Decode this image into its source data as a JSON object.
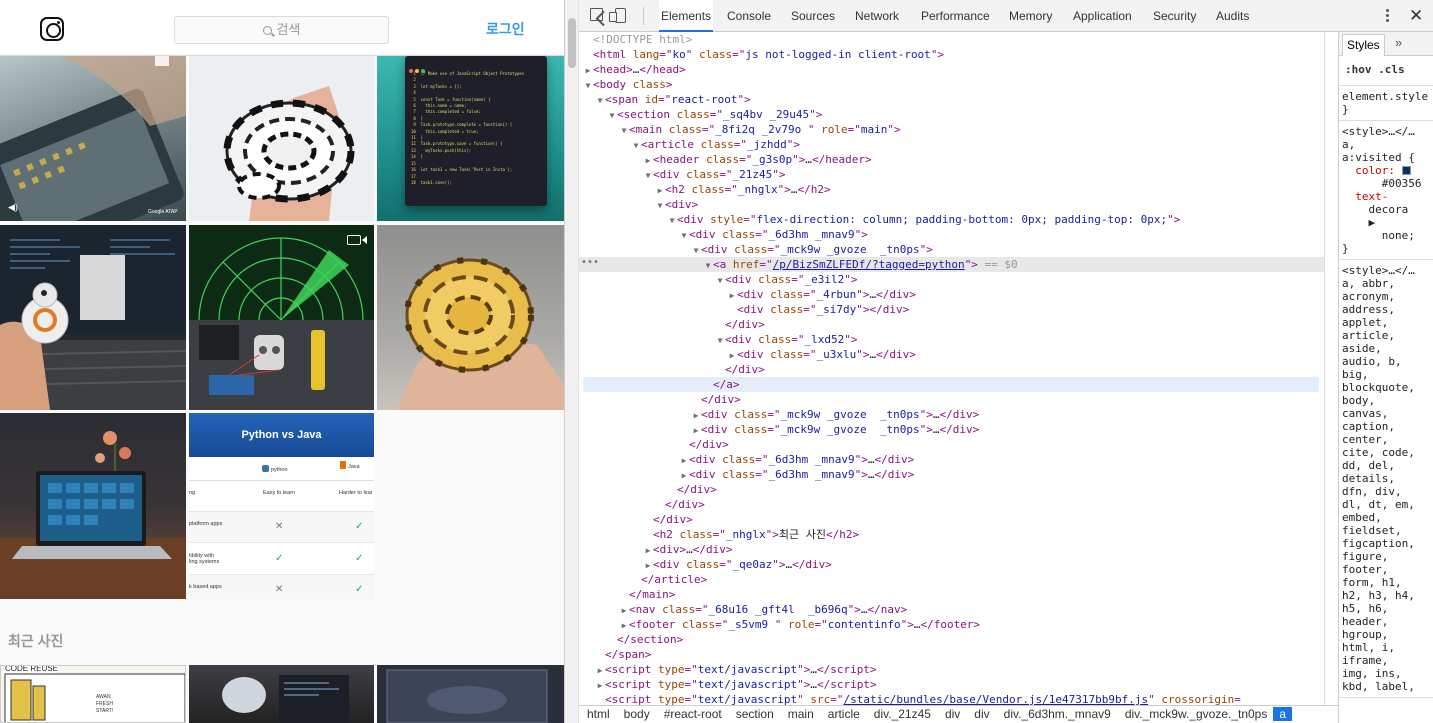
{
  "instagram": {
    "search_placeholder": "검색",
    "login_label": "로그인",
    "recent_photos_title": "최근 사진",
    "python_vs_java": {
      "title": "Python vs Java",
      "col1": "python",
      "col2": "Java",
      "rows": [
        {
          "label": "ng",
          "py": "Easy to learn",
          "java": "Harder to lear"
        },
        {
          "label": "platform apps",
          "py": "✕",
          "java": "✓"
        },
        {
          "label": "tibility with\nling systems",
          "py": "✓",
          "java": "✓"
        },
        {
          "label": "k based apps",
          "py": "✕",
          "java": "✓"
        }
      ]
    },
    "code_tile_lines": [
      "// Make use of JavaScript Object Prototypes",
      "",
      "let myTasks = [];",
      "",
      "const Task = function(name) {",
      "  this.name = name;",
      "  this.completed = false;",
      "}",
      "Task.prototype.complete = function() {",
      "  this.completed = true;",
      "}",
      "Task.prototype.save = function() {",
      "  myTasks.push(this);",
      "}",
      "",
      "let task1 = new Task('Post in Insta');",
      "",
      "task1.save();"
    ],
    "comic_text": "CODE  REUSE",
    "google_label": "Google ATAP"
  },
  "devtools": {
    "tabs": [
      "Elements",
      "Console",
      "Sources",
      "Network",
      "Performance",
      "Memory",
      "Application",
      "Security",
      "Audits"
    ],
    "active_tab": "Elements",
    "dom_lines": [
      {
        "indent": 0,
        "tw": "",
        "html": "<span class='cmt'>&lt;!DOCTYPE html&gt;</span>"
      },
      {
        "indent": 0,
        "tw": "",
        "html": "&lt;html <span class='attr'>lang</span>=\"<span class='val'>ko</span>\" <span class='attr'>class</span>=\"<span class='val'>js not-logged-in client-root</span>\"&gt;"
      },
      {
        "indent": 0,
        "tw": "▶",
        "html": "&lt;head&gt;<span class='txt'>…</span>&lt;/head&gt;"
      },
      {
        "indent": 0,
        "tw": "▼",
        "html": "&lt;body <span class='attr'>class</span>&gt;"
      },
      {
        "indent": 1,
        "tw": "▼",
        "html": "&lt;span <span class='attr'>id</span>=\"<span class='val'>react-root</span>\"&gt;"
      },
      {
        "indent": 2,
        "tw": "▼",
        "html": "&lt;section <span class='attr'>class</span>=\"<span class='val'>_sq4bv _29u45</span>\"&gt;"
      },
      {
        "indent": 3,
        "tw": "▼",
        "html": "&lt;main <span class='attr'>class</span>=\"<span class='val'>_8fi2q _2v79o </span>\" <span class='attr'>role</span>=\"<span class='val'>main</span>\"&gt;"
      },
      {
        "indent": 4,
        "tw": "▼",
        "html": "&lt;article <span class='attr'>class</span>=\"<span class='val'>_jzhdd</span>\"&gt;"
      },
      {
        "indent": 5,
        "tw": "▶",
        "html": "&lt;header <span class='attr'>class</span>=\"<span class='val'>_g3s0p</span>\"&gt;<span class='txt'>…</span>&lt;/header&gt;"
      },
      {
        "indent": 5,
        "tw": "▼",
        "html": "&lt;div <span class='attr'>class</span>=\"<span class='val'>_21z45</span>\"&gt;"
      },
      {
        "indent": 6,
        "tw": "▶",
        "html": "&lt;h2 <span class='attr'>class</span>=\"<span class='val'>_nhglx</span>\"&gt;<span class='txt'>…</span>&lt;/h2&gt;"
      },
      {
        "indent": 6,
        "tw": "▼",
        "html": "&lt;div&gt;"
      },
      {
        "indent": 7,
        "tw": "▼",
        "html": "&lt;div <span class='attr'>style</span>=\"<span class='val'>flex-direction: column; padding-bottom: 0px; padding-top: 0px;</span>\"&gt;"
      },
      {
        "indent": 8,
        "tw": "▼",
        "html": "&lt;div <span class='attr'>class</span>=\"<span class='val'>_6d3hm _mnav9</span>\"&gt;"
      },
      {
        "indent": 9,
        "tw": "▼",
        "html": "&lt;div <span class='attr'>class</span>=\"<span class='val'>_mck9w _gvoze  _tn0ps</span>\"&gt;"
      },
      {
        "indent": 10,
        "tw": "▼",
        "html": "&lt;a <span class='attr'>href</span>=\"<span class='link'>/p/BizSmZLFEDf/?tagged=python</span>\"&gt; <span class='eq'>== $0</span>"
      },
      {
        "indent": 11,
        "tw": "▼",
        "html": "&lt;div <span class='attr'>class</span>=\"<span class='val'>_e3il2</span>\"&gt;"
      },
      {
        "indent": 12,
        "tw": "▶",
        "html": "&lt;div <span class='attr'>class</span>=\"<span class='val'>_4rbun</span>\"&gt;<span class='txt'>…</span>&lt;/div&gt;"
      },
      {
        "indent": 12,
        "tw": "",
        "html": "&lt;div <span class='attr'>class</span>=\"<span class='val'>_si7dy</span>\"&gt;&lt;/div&gt;"
      },
      {
        "indent": 11,
        "tw": "",
        "html": "&lt;/div&gt;"
      },
      {
        "indent": 11,
        "tw": "▼",
        "html": "&lt;div <span class='attr'>class</span>=\"<span class='val'>_lxd52</span>\"&gt;"
      },
      {
        "indent": 12,
        "tw": "▶",
        "html": "&lt;div <span class='attr'>class</span>=\"<span class='val'>_u3xlu</span>\"&gt;<span class='txt'>…</span>&lt;/div&gt;"
      },
      {
        "indent": 11,
        "tw": "",
        "html": "&lt;/div&gt;"
      },
      {
        "indent": 10,
        "tw": "",
        "html": "&lt;/a&gt;"
      },
      {
        "indent": 9,
        "tw": "",
        "html": "&lt;/div&gt;"
      },
      {
        "indent": 9,
        "tw": "▶",
        "html": "&lt;div <span class='attr'>class</span>=\"<span class='val'>_mck9w _gvoze  _tn0ps</span>\"&gt;<span class='txt'>…</span>&lt;/div&gt;"
      },
      {
        "indent": 9,
        "tw": "▶",
        "html": "&lt;div <span class='attr'>class</span>=\"<span class='val'>_mck9w _gvoze  _tn0ps</span>\"&gt;<span class='txt'>…</span>&lt;/div&gt;"
      },
      {
        "indent": 8,
        "tw": "",
        "html": "&lt;/div&gt;"
      },
      {
        "indent": 8,
        "tw": "▶",
        "html": "&lt;div <span class='attr'>class</span>=\"<span class='val'>_6d3hm _mnav9</span>\"&gt;<span class='txt'>…</span>&lt;/div&gt;"
      },
      {
        "indent": 8,
        "tw": "▶",
        "html": "&lt;div <span class='attr'>class</span>=\"<span class='val'>_6d3hm _mnav9</span>\"&gt;<span class='txt'>…</span>&lt;/div&gt;"
      },
      {
        "indent": 7,
        "tw": "",
        "html": "&lt;/div&gt;"
      },
      {
        "indent": 6,
        "tw": "",
        "html": "&lt;/div&gt;"
      },
      {
        "indent": 5,
        "tw": "",
        "html": "&lt;/div&gt;"
      },
      {
        "indent": 5,
        "tw": "",
        "html": "&lt;h2 <span class='attr'>class</span>=\"<span class='val'>_nhglx</span>\"&gt;<span class='txt'>최근 사진</span>&lt;/h2&gt;"
      },
      {
        "indent": 5,
        "tw": "▶",
        "html": "&lt;div&gt;<span class='txt'>…</span>&lt;/div&gt;"
      },
      {
        "indent": 5,
        "tw": "▶",
        "html": "&lt;div <span class='attr'>class</span>=\"<span class='val'>_qe0az</span>\"&gt;<span class='txt'>…</span>&lt;/div&gt;"
      },
      {
        "indent": 4,
        "tw": "",
        "html": "&lt;/article&gt;"
      },
      {
        "indent": 3,
        "tw": "",
        "html": "&lt;/main&gt;"
      },
      {
        "indent": 3,
        "tw": "▶",
        "html": "&lt;nav <span class='attr'>class</span>=\"<span class='val'>_68u16 _gft4l  _b696q</span>\"&gt;<span class='txt'>…</span>&lt;/nav&gt;"
      },
      {
        "indent": 3,
        "tw": "▶",
        "html": "&lt;footer <span class='attr'>class</span>=\"<span class='val'>_s5vm9 </span>\" <span class='attr'>role</span>=\"<span class='val'>contentinfo</span>\"&gt;<span class='txt'>…</span>&lt;/footer&gt;"
      },
      {
        "indent": 2,
        "tw": "",
        "html": "&lt;/section&gt;"
      },
      {
        "indent": 1,
        "tw": "",
        "html": "&lt;/span&gt;"
      },
      {
        "indent": 1,
        "tw": "▶",
        "html": "&lt;script <span class='attr'>type</span>=\"<span class='val'>text/javascript</span>\"&gt;<span class='txt'>…</span>&lt;/script&gt;"
      },
      {
        "indent": 1,
        "tw": "▶",
        "html": "&lt;script <span class='attr'>type</span>=\"<span class='val'>text/javascript</span>\"&gt;<span class='txt'>…</span>&lt;/script&gt;"
      },
      {
        "indent": 1,
        "tw": "",
        "html": "&lt;script <span class='attr'>type</span>=\"<span class='val'>text/javascript</span>\" <span class='attr'>src</span>=\"<span class='link'>/static/bundles/base/Vendor.js/1e47317bb9bf.js</span>\" <span class='attr'>crossorigin</span>="
      }
    ],
    "selected_line": 15,
    "hover_line": 23,
    "breadcrumbs": [
      "html",
      "body",
      "#react-root",
      "section",
      "main",
      "article",
      "div._21z45",
      "div",
      "div",
      "div._6d3hm._mnav9",
      "div._mck9w._gvoze._tn0ps",
      "a"
    ],
    "styles": {
      "tab_label": "Styles",
      "more": "»",
      "hov_cls": ":hov  .cls",
      "blocks": [
        "element.style {\n}",
        "<style>…</…\na,\na:visited {\n  color: ■\n      #00356\n  text-\n    decora\n    ▶\n      none;\n}",
        "<style>…</…\na, abbr,\nacronym,\naddress,\napplet,\narticle,\naside,\naudio, b,\nbig,\nblockquote,\nbody,\ncanvas,\ncaption,\ncenter,\ncite, code,\ndd, del,\ndetails,\ndfn, div,\ndl, dt, em,\nembed,\nfieldset,\nfigcaption,\nfigure,\nfooter,\nform, h1,\nh2, h3, h4,\nh5, h6,\nheader,\nhgroup,\nhtml, i,\niframe,\nimg, ins,\nkbd, label,"
      ]
    }
  }
}
